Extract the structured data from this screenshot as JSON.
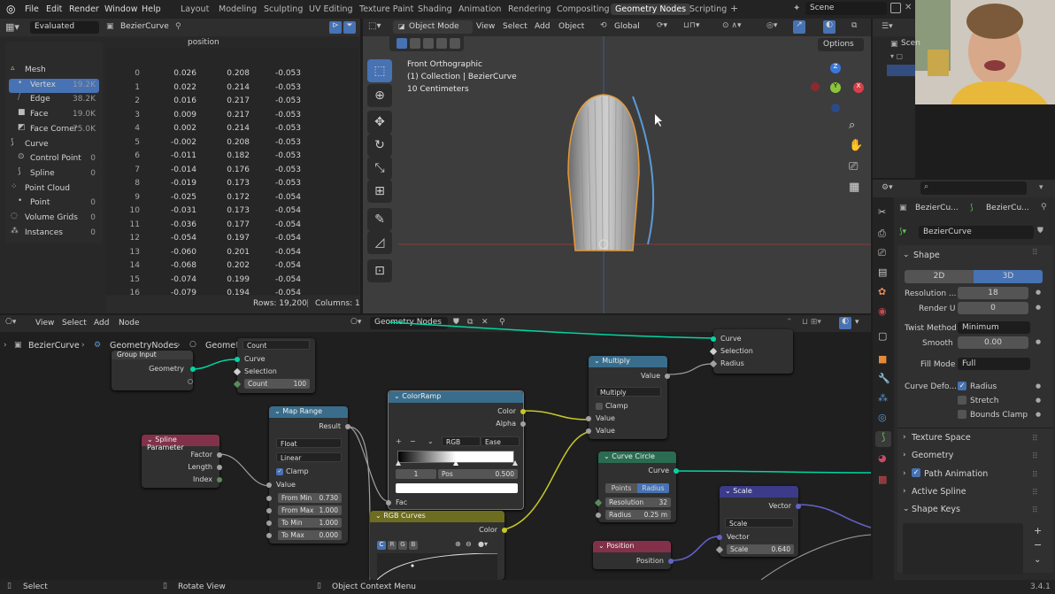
{
  "topbar": {
    "menus": [
      "File",
      "Edit",
      "Render",
      "Window",
      "Help"
    ],
    "workspaces": [
      "Layout",
      "Modeling",
      "Sculpting",
      "UV Editing",
      "Texture Paint",
      "Shading",
      "Animation",
      "Rendering",
      "Compositing",
      "Geometry Nodes",
      "Scripting"
    ],
    "active_workspace": "Geometry Nodes",
    "add_tab": "+",
    "scene": "Scene"
  },
  "spreadsheet": {
    "mode": "Evaluated",
    "object": "BezierCurve",
    "column_header": "position",
    "sidebar": [
      {
        "label": "Mesh",
        "count": "",
        "level": 0
      },
      {
        "label": "Vertex",
        "count": "19.2K",
        "level": 1
      },
      {
        "label": "Edge",
        "count": "38.2K",
        "level": 1
      },
      {
        "label": "Face",
        "count": "19.0K",
        "level": 1
      },
      {
        "label": "Face Corner",
        "count": "75.0K",
        "level": 1
      },
      {
        "label": "Curve",
        "count": "",
        "level": 0
      },
      {
        "label": "Control Point",
        "count": "0",
        "level": 1
      },
      {
        "label": "Spline",
        "count": "0",
        "level": 1
      },
      {
        "label": "Point Cloud",
        "count": "",
        "level": 0
      },
      {
        "label": "Point",
        "count": "0",
        "level": 1
      },
      {
        "label": "Volume Grids",
        "count": "0",
        "level": 0
      },
      {
        "label": "Instances",
        "count": "0",
        "level": 0
      }
    ],
    "rows": [
      [
        "0",
        "0.026",
        "0.208",
        "-0.053"
      ],
      [
        "1",
        "0.022",
        "0.214",
        "-0.053"
      ],
      [
        "2",
        "0.016",
        "0.217",
        "-0.053"
      ],
      [
        "3",
        "0.009",
        "0.217",
        "-0.053"
      ],
      [
        "4",
        "0.002",
        "0.214",
        "-0.053"
      ],
      [
        "5",
        "-0.002",
        "0.208",
        "-0.053"
      ],
      [
        "6",
        "-0.011",
        "0.182",
        "-0.053"
      ],
      [
        "7",
        "-0.014",
        "0.176",
        "-0.053"
      ],
      [
        "8",
        "-0.019",
        "0.173",
        "-0.053"
      ],
      [
        "9",
        "-0.025",
        "0.172",
        "-0.054"
      ],
      [
        "10",
        "-0.031",
        "0.173",
        "-0.054"
      ],
      [
        "11",
        "-0.036",
        "0.177",
        "-0.054"
      ],
      [
        "12",
        "-0.054",
        "0.197",
        "-0.054"
      ],
      [
        "13",
        "-0.060",
        "0.201",
        "-0.054"
      ],
      [
        "14",
        "-0.068",
        "0.202",
        "-0.054"
      ],
      [
        "15",
        "-0.074",
        "0.199",
        "-0.054"
      ],
      [
        "16",
        "-0.079",
        "0.194",
        "-0.054"
      ],
      [
        "17",
        "-0.080",
        "0.186",
        "-0.054"
      ]
    ],
    "footer_rows": "Rows: 19,200",
    "footer_cols": "Columns: 1"
  },
  "viewport": {
    "mode": "Object Mode",
    "menus": [
      "View",
      "Select",
      "Add",
      "Object"
    ],
    "orientation": "Global",
    "options": "Options",
    "info_line1": "Front Orthographic",
    "info_line2": "(1) Collection | BezierCurve",
    "info_line3": "10 Centimeters",
    "axes": {
      "x": "X",
      "y": "Y",
      "z": "Z"
    }
  },
  "node_editor": {
    "menus": [
      "View",
      "Select",
      "Add",
      "Node"
    ],
    "tree_name": "Geometry Nodes",
    "breadcrumb": [
      "BezierCurve",
      "GeometryNodes",
      "Geometry Nodes"
    ],
    "nodes": {
      "group_input": {
        "title": "Group Input",
        "geometry": "Geometry"
      },
      "resample": {
        "mode": "Count",
        "curve": "Curve",
        "selection": "Selection",
        "count_label": "Count",
        "count_value": "100"
      },
      "spline_param": {
        "title": "Spline Parameter",
        "factor": "Factor",
        "length": "Length",
        "index": "Index"
      },
      "map_range": {
        "title": "Map Range",
        "result": "Result",
        "type": "Float",
        "interp": "Linear",
        "clamp": "Clamp",
        "value": "Value",
        "from_min_label": "From Min",
        "from_min": "0.730",
        "from_max_label": "From Max",
        "from_max": "1.000",
        "to_min_label": "To Min",
        "to_min": "1.000",
        "to_max_label": "To Max",
        "to_max": "0.000"
      },
      "color_ramp": {
        "title": "ColorRamp",
        "color": "Color",
        "alpha": "Alpha",
        "mode": "RGB",
        "interp": "Ease",
        "index": "1",
        "pos_label": "Pos",
        "pos_value": "0.500",
        "fac": "Fac"
      },
      "rgb_curves": {
        "title": "RGB Curves",
        "color": "Color",
        "channels": [
          "C",
          "R",
          "G",
          "B"
        ]
      },
      "multiply": {
        "title": "Multiply",
        "value": "Value",
        "op": "Multiply",
        "clamp": "Clamp",
        "in1": "Value",
        "in2": "Value"
      },
      "curve_circle": {
        "title": "Curve Circle",
        "curve": "Curve",
        "tab1": "Points",
        "tab2": "Radius",
        "res_label": "Resolution",
        "res_value": "32",
        "radius_label": "Radius",
        "radius_value": "0.25 m"
      },
      "scale": {
        "title": "Scale",
        "vector_out": "Vector",
        "op": "Scale",
        "vector_in": "Vector",
        "scale_label": "Scale",
        "scale_value": "0.640"
      },
      "position": {
        "title": "Position",
        "position": "Position"
      },
      "curve_to_mesh": {
        "curve": "Curve",
        "selection": "Selection",
        "radius": "Radius"
      }
    }
  },
  "outliner": {
    "scene_label": "Scen"
  },
  "properties": {
    "breadcrumb1": "BezierCu...",
    "breadcrumb2": "BezierCu...",
    "name": "BezierCurve",
    "shape": "Shape",
    "dim_2d": "2D",
    "dim_3d": "3D",
    "res_label": "Resolution ...",
    "res_value": "18",
    "render_label": "Render U",
    "render_value": "0",
    "twist_label": "Twist Method",
    "twist_value": "Minimum",
    "smooth_label": "Smooth",
    "smooth_value": "0.00",
    "fill_label": "Fill Mode",
    "fill_value": "Full",
    "deform_label": "Curve Defo...",
    "radius_cb": "Radius",
    "stretch_cb": "Stretch",
    "bounds_cb": "Bounds Clamp",
    "sections": [
      "Texture Space",
      "Geometry",
      "Path Animation",
      "Active Spline",
      "Shape Keys"
    ]
  },
  "statusbar": {
    "select": "Select",
    "rotate": "Rotate View",
    "context": "Object Context Menu",
    "version": "3.4.1"
  }
}
